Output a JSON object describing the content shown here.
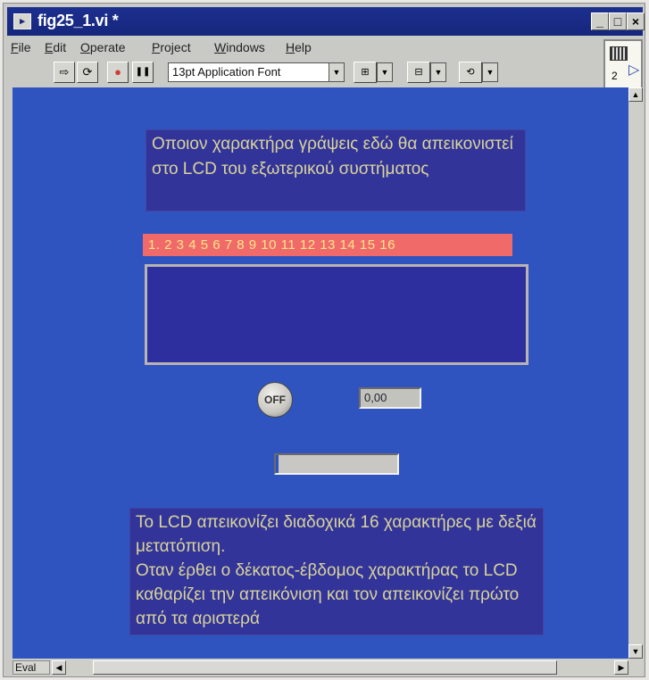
{
  "window": {
    "title": "fig25_1.vi *",
    "title_icon": "▸",
    "controls": [
      "_",
      "□",
      "×"
    ]
  },
  "menu": {
    "items": [
      {
        "mnemonic": "F",
        "rest": "ile"
      },
      {
        "mnemonic": "E",
        "rest": "dit"
      },
      {
        "mnemonic": "O",
        "rest": "perate"
      },
      {
        "mnemonic": "P",
        "rest": "roject"
      },
      {
        "mnemonic": "W",
        "rest": "indows"
      },
      {
        "mnemonic": "H",
        "rest": "elp"
      }
    ]
  },
  "toolbar": {
    "run_icon": "⇨",
    "run_continuous_icon": "⟳",
    "abort_icon": "●",
    "pause_icon": "❚❚",
    "font_selector": "13pt Application Font",
    "dropdown_arrow": "▼"
  },
  "vi_icon": {
    "connector_number": "2",
    "arrow": "▷"
  },
  "panel": {
    "top_label": "Οποιον χαρακτήρα γράψεις εδώ θα απεικονιστεί στο LCD του εξωτερικού συστήματος",
    "position_numbers": "1. 2  3  4  5  6  7  8  9  10 11 12 13 14 15 16",
    "lcd_text": "",
    "off_button_label": "OFF",
    "numeric_value": "0,00",
    "progress_fraction": 0.02,
    "bottom_label": "Το LCD απεικονίζει διαδοχικά 16 χαρακτήρες με δεξιά μετατόπιση.\nΟταν έρθει ο δέκατος-έβδομος χαρακτήρας το LCD καθαρίζει την απεικόνιση και τον απεικονίζει πρώτο από τα αριστερά"
  },
  "scrollbars": {
    "up_arrow": "▲",
    "down_arrow": "▼",
    "left_arrow": "◀",
    "right_arrow": "▶",
    "mode_label": "Eval"
  },
  "colors": {
    "panel_bg": "#2f54c0",
    "label_bg": "#33349a",
    "label_text": "#d8d49a",
    "strip_bg": "#f06a6a",
    "strip_text": "#ffe68a"
  }
}
